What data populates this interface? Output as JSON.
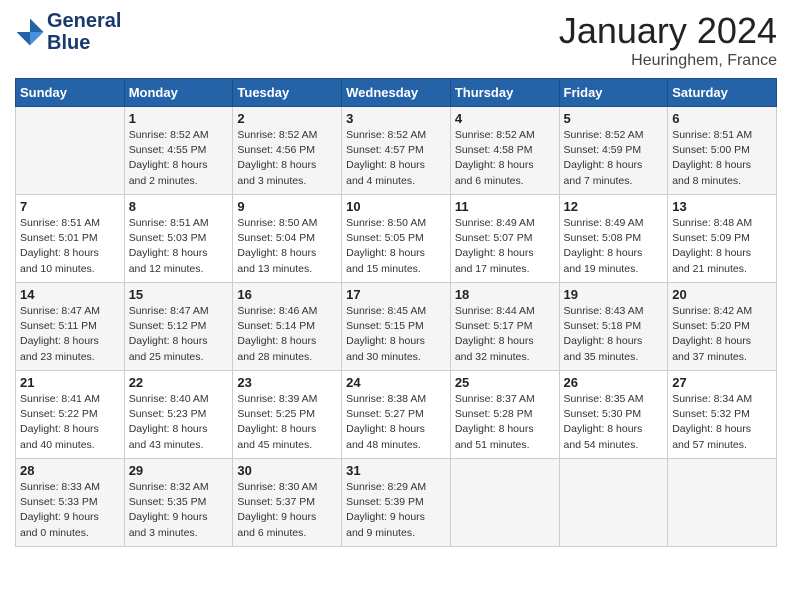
{
  "header": {
    "logo_line1": "General",
    "logo_line2": "Blue",
    "month": "January 2024",
    "location": "Heuringhem, France"
  },
  "days_of_week": [
    "Sunday",
    "Monday",
    "Tuesday",
    "Wednesday",
    "Thursday",
    "Friday",
    "Saturday"
  ],
  "weeks": [
    [
      {
        "day": "",
        "info": ""
      },
      {
        "day": "1",
        "info": "Sunrise: 8:52 AM\nSunset: 4:55 PM\nDaylight: 8 hours\nand 2 minutes."
      },
      {
        "day": "2",
        "info": "Sunrise: 8:52 AM\nSunset: 4:56 PM\nDaylight: 8 hours\nand 3 minutes."
      },
      {
        "day": "3",
        "info": "Sunrise: 8:52 AM\nSunset: 4:57 PM\nDaylight: 8 hours\nand 4 minutes."
      },
      {
        "day": "4",
        "info": "Sunrise: 8:52 AM\nSunset: 4:58 PM\nDaylight: 8 hours\nand 6 minutes."
      },
      {
        "day": "5",
        "info": "Sunrise: 8:52 AM\nSunset: 4:59 PM\nDaylight: 8 hours\nand 7 minutes."
      },
      {
        "day": "6",
        "info": "Sunrise: 8:51 AM\nSunset: 5:00 PM\nDaylight: 8 hours\nand 8 minutes."
      }
    ],
    [
      {
        "day": "7",
        "info": "Sunrise: 8:51 AM\nSunset: 5:01 PM\nDaylight: 8 hours\nand 10 minutes."
      },
      {
        "day": "8",
        "info": "Sunrise: 8:51 AM\nSunset: 5:03 PM\nDaylight: 8 hours\nand 12 minutes."
      },
      {
        "day": "9",
        "info": "Sunrise: 8:50 AM\nSunset: 5:04 PM\nDaylight: 8 hours\nand 13 minutes."
      },
      {
        "day": "10",
        "info": "Sunrise: 8:50 AM\nSunset: 5:05 PM\nDaylight: 8 hours\nand 15 minutes."
      },
      {
        "day": "11",
        "info": "Sunrise: 8:49 AM\nSunset: 5:07 PM\nDaylight: 8 hours\nand 17 minutes."
      },
      {
        "day": "12",
        "info": "Sunrise: 8:49 AM\nSunset: 5:08 PM\nDaylight: 8 hours\nand 19 minutes."
      },
      {
        "day": "13",
        "info": "Sunrise: 8:48 AM\nSunset: 5:09 PM\nDaylight: 8 hours\nand 21 minutes."
      }
    ],
    [
      {
        "day": "14",
        "info": "Sunrise: 8:47 AM\nSunset: 5:11 PM\nDaylight: 8 hours\nand 23 minutes."
      },
      {
        "day": "15",
        "info": "Sunrise: 8:47 AM\nSunset: 5:12 PM\nDaylight: 8 hours\nand 25 minutes."
      },
      {
        "day": "16",
        "info": "Sunrise: 8:46 AM\nSunset: 5:14 PM\nDaylight: 8 hours\nand 28 minutes."
      },
      {
        "day": "17",
        "info": "Sunrise: 8:45 AM\nSunset: 5:15 PM\nDaylight: 8 hours\nand 30 minutes."
      },
      {
        "day": "18",
        "info": "Sunrise: 8:44 AM\nSunset: 5:17 PM\nDaylight: 8 hours\nand 32 minutes."
      },
      {
        "day": "19",
        "info": "Sunrise: 8:43 AM\nSunset: 5:18 PM\nDaylight: 8 hours\nand 35 minutes."
      },
      {
        "day": "20",
        "info": "Sunrise: 8:42 AM\nSunset: 5:20 PM\nDaylight: 8 hours\nand 37 minutes."
      }
    ],
    [
      {
        "day": "21",
        "info": "Sunrise: 8:41 AM\nSunset: 5:22 PM\nDaylight: 8 hours\nand 40 minutes."
      },
      {
        "day": "22",
        "info": "Sunrise: 8:40 AM\nSunset: 5:23 PM\nDaylight: 8 hours\nand 43 minutes."
      },
      {
        "day": "23",
        "info": "Sunrise: 8:39 AM\nSunset: 5:25 PM\nDaylight: 8 hours\nand 45 minutes."
      },
      {
        "day": "24",
        "info": "Sunrise: 8:38 AM\nSunset: 5:27 PM\nDaylight: 8 hours\nand 48 minutes."
      },
      {
        "day": "25",
        "info": "Sunrise: 8:37 AM\nSunset: 5:28 PM\nDaylight: 8 hours\nand 51 minutes."
      },
      {
        "day": "26",
        "info": "Sunrise: 8:35 AM\nSunset: 5:30 PM\nDaylight: 8 hours\nand 54 minutes."
      },
      {
        "day": "27",
        "info": "Sunrise: 8:34 AM\nSunset: 5:32 PM\nDaylight: 8 hours\nand 57 minutes."
      }
    ],
    [
      {
        "day": "28",
        "info": "Sunrise: 8:33 AM\nSunset: 5:33 PM\nDaylight: 9 hours\nand 0 minutes."
      },
      {
        "day": "29",
        "info": "Sunrise: 8:32 AM\nSunset: 5:35 PM\nDaylight: 9 hours\nand 3 minutes."
      },
      {
        "day": "30",
        "info": "Sunrise: 8:30 AM\nSunset: 5:37 PM\nDaylight: 9 hours\nand 6 minutes."
      },
      {
        "day": "31",
        "info": "Sunrise: 8:29 AM\nSunset: 5:39 PM\nDaylight: 9 hours\nand 9 minutes."
      },
      {
        "day": "",
        "info": ""
      },
      {
        "day": "",
        "info": ""
      },
      {
        "day": "",
        "info": ""
      }
    ]
  ]
}
